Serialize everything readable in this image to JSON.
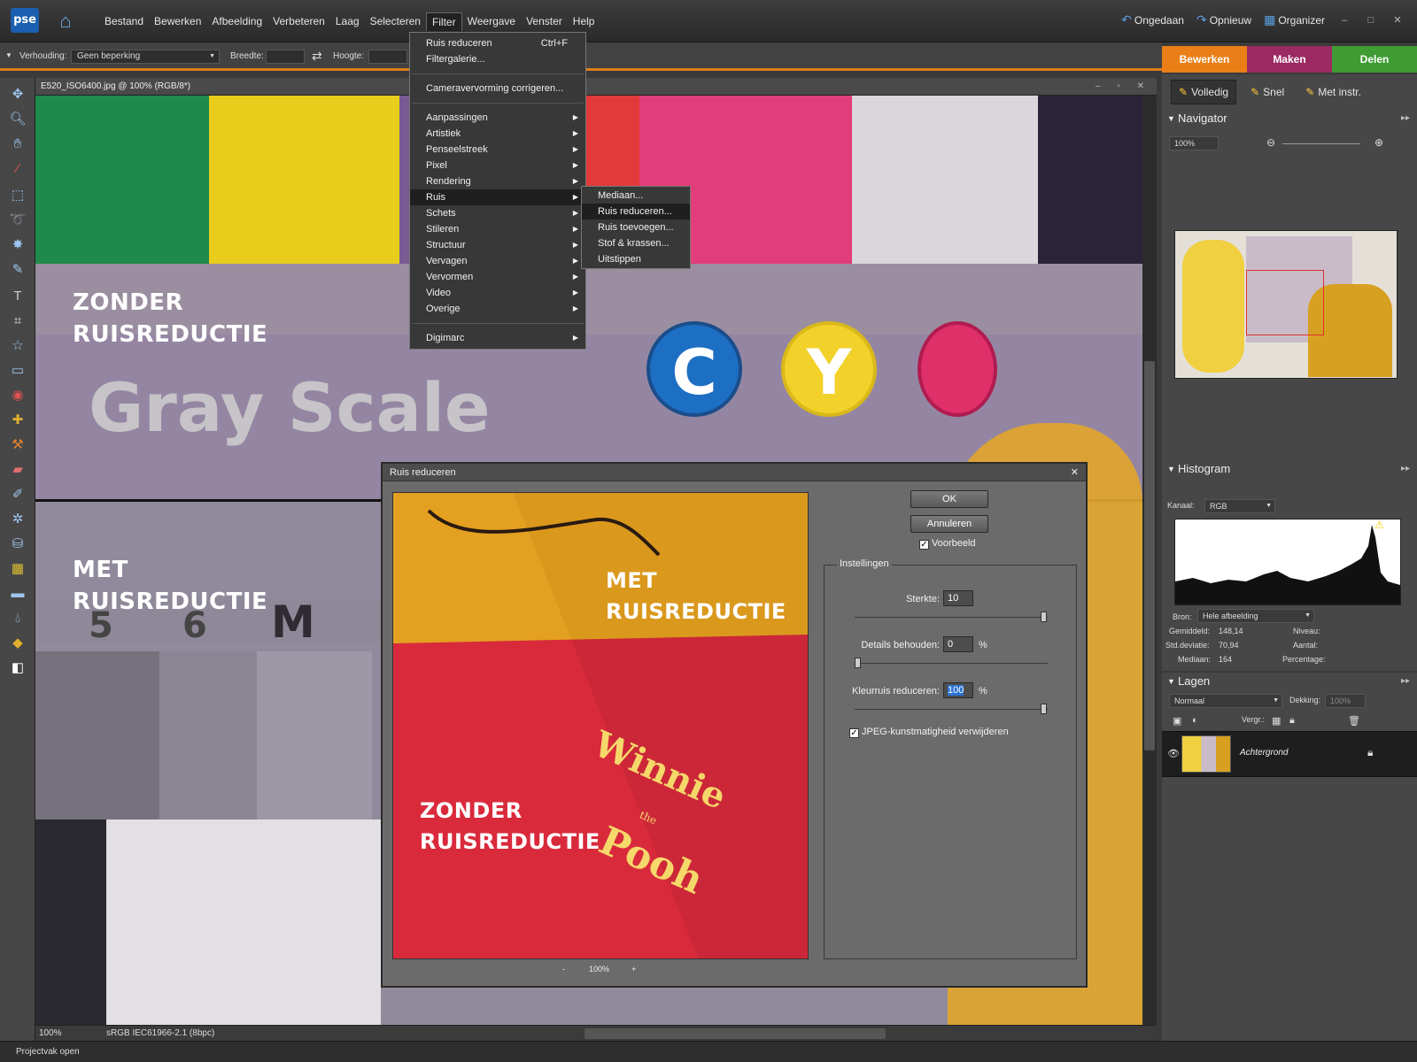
{
  "app": {
    "logo": "pse",
    "doc_title": "E520_ISO6400.jpg @ 100% (RGB/8*)"
  },
  "menubar": [
    "Bestand",
    "Bewerken",
    "Afbeelding",
    "Verbeteren",
    "Laag",
    "Selecteren",
    "Filter",
    "Weergave",
    "Venster",
    "Help"
  ],
  "topright": {
    "undo": "Ongedaan",
    "redo": "Opnieuw",
    "organizer": "Organizer"
  },
  "optionsbar": {
    "ratio_label": "Verhouding:",
    "ratio_value": "Geen beperking",
    "width_label": "Breedte:",
    "height_label": "Hoogte:"
  },
  "modetabs": {
    "edit": "Bewerken",
    "make": "Maken",
    "share": "Delen"
  },
  "subtabs": {
    "full": "Volledig",
    "quick": "Snel",
    "guided": "Met instr."
  },
  "filter_menu": {
    "top": [
      {
        "label": "Ruis reduceren",
        "shortcut": "Ctrl+F"
      },
      {
        "label": "Filtergalerie..."
      }
    ],
    "camera": "Cameravervorming corrigeren...",
    "groups": [
      "Aanpassingen",
      "Artistiek",
      "Penseelstreek",
      "Pixel",
      "Rendering",
      "Ruis",
      "Schets",
      "Stileren",
      "Structuur",
      "Vervagen",
      "Vervormen",
      "Video",
      "Overige"
    ],
    "digimarc": "Digimarc"
  },
  "noise_submenu": [
    "Mediaan...",
    "Ruis reduceren...",
    "Ruis toevoegen...",
    "Stof & krassen...",
    "Uitstippen"
  ],
  "canvas": {
    "label_without_1": "ZONDER",
    "label_without_2": "RUISREDUCTIE",
    "label_with_1": "MET",
    "label_with_2": "RUISREDUCTIE",
    "gray_scale": "Gray Scale",
    "circle_c": "C",
    "circle_y": "Y",
    "num_5": "5",
    "num_6": "6",
    "num_m": "M"
  },
  "dialog": {
    "title": "Ruis reduceren",
    "ok": "OK",
    "cancel": "Annuleren",
    "preview_label": "Voorbeeld",
    "settings": "Instellingen",
    "strength_label": "Sterkte:",
    "strength_value": "10",
    "details_label": "Details behouden:",
    "details_value": "0",
    "color_label": "Kleurruis reduceren:",
    "color_value": "100",
    "percent": "%",
    "jpeg_label": "JPEG-kunstmatigheid verwijderen",
    "zoom": "100%",
    "minus": "-",
    "plus": "+",
    "prev_with_1": "MET",
    "prev_with_2": "RUISREDUCTIE",
    "prev_without_1": "ZONDER",
    "prev_without_2": "RUISREDUCTIE",
    "winnie": "Winnie",
    "the": "the",
    "pooh": "Pooh",
    "strength_level": 1.0,
    "details_level": 0.0,
    "color_level": 1.0
  },
  "navigator": {
    "title": "Navigator",
    "zoom": "100%"
  },
  "histogram": {
    "title": "Histogram",
    "channel_label": "Kanaal:",
    "channel_value": "RGB",
    "source_label": "Bron:",
    "source_value": "Hele afbeelding",
    "mean_label": "Gemiddeld:",
    "mean_value": "148,14",
    "std_label": "Std.deviatie:",
    "std_value": "70,94",
    "median_label": "Mediaan:",
    "median_value": "164",
    "level_label": "Niveau:",
    "count_label": "Aantal:",
    "pct_label": "Percentage:"
  },
  "layers": {
    "title": "Lagen",
    "blend": "Normaal",
    "opacity_label": "Dekking:",
    "opacity_value": "100%",
    "lock_label": "Vergr.:",
    "layer_name": "Achtergrond"
  },
  "statusbar": {
    "zoom": "100%",
    "profile": "sRGB IEC61966-2.1 (8bpc)"
  },
  "bottombar": {
    "project": "Projectvak open"
  }
}
